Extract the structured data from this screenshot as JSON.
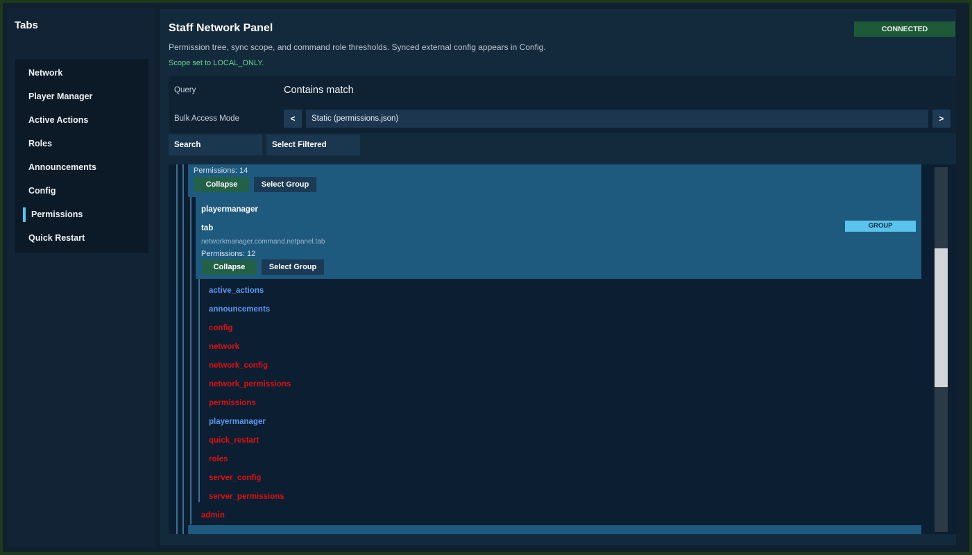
{
  "sidebar": {
    "title": "Tabs",
    "items": [
      {
        "label": "Network"
      },
      {
        "label": "Player Manager"
      },
      {
        "label": "Active Actions"
      },
      {
        "label": "Roles"
      },
      {
        "label": "Announcements"
      },
      {
        "label": "Config"
      },
      {
        "label": "Permissions",
        "active": true
      },
      {
        "label": "Quick Restart"
      }
    ]
  },
  "header": {
    "title": "Staff Network Panel",
    "status": "CONNECTED",
    "description": "Permission tree, sync scope, and command role thresholds. Synced external config appears in Config.",
    "scope_message": "Scope set to LOCAL_ONLY."
  },
  "form": {
    "query_label": "Query",
    "query_value": "Contains match",
    "bulk_label": "Bulk Access Mode",
    "prev_label": "<",
    "next_label": ">",
    "bulk_value": "Static (permissions.json)"
  },
  "toolbar": {
    "search_label": "Search",
    "select_filtered_label": "Select Filtered"
  },
  "tree": {
    "outer_group": {
      "permissions_count": "Permissions: 14",
      "collapse_label": "Collapse",
      "select_group_label": "Select Group"
    },
    "inner_group": {
      "parent_name": "playermanager",
      "name": "tab",
      "badge": "GROUP",
      "path": "networkmanager.command.netpanel.tab",
      "permissions_count": "Permissions: 12",
      "collapse_label": "Collapse",
      "select_group_label": "Select Group"
    },
    "children": [
      {
        "label": "active_actions",
        "state": "allowed"
      },
      {
        "label": "announcements",
        "state": "allowed"
      },
      {
        "label": "config",
        "state": "denied"
      },
      {
        "label": "network",
        "state": "denied"
      },
      {
        "label": "network_config",
        "state": "denied"
      },
      {
        "label": "network_permissions",
        "state": "denied"
      },
      {
        "label": "permissions",
        "state": "denied"
      },
      {
        "label": "playermanager",
        "state": "allowed"
      },
      {
        "label": "quick_restart",
        "state": "denied"
      },
      {
        "label": "roles",
        "state": "denied"
      },
      {
        "label": "server_config",
        "state": "denied"
      },
      {
        "label": "server_permissions",
        "state": "denied"
      }
    ],
    "sibling_item": {
      "label": "admin",
      "state": "denied"
    }
  },
  "colors": {
    "allowed": "#5a9bf0",
    "denied": "#e01010",
    "accent": "#53c6ee",
    "connected": "#1e5a37"
  }
}
